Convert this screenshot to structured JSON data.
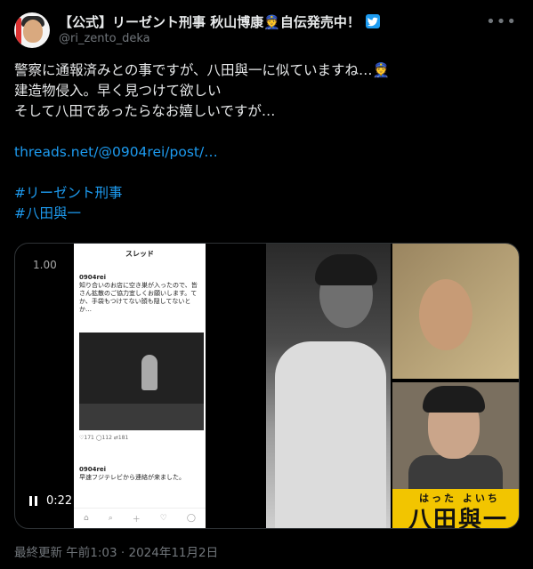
{
  "author": {
    "display_name": "【公式】リーゼント刑事 秋山博康👮自伝発売中！",
    "handle": "@ri_zento_deka"
  },
  "post": {
    "lines": [
      "警察に通報済みとの事ですが、八田與一に似ていますね…👮",
      "建造物侵入。早く見つけて欲しい",
      "そして八田であったらなお嬉しいですが…"
    ],
    "link": "threads.net/@0904rei/post/…",
    "hashtags": [
      "#リーゼント刑事",
      "#八田與一"
    ]
  },
  "media": {
    "playback_speed": "1.00",
    "elapsed_time": "0:22",
    "phone_header": "スレッド",
    "phone_user": "0904rei",
    "phone_post_text": "知り合いのお店に空き巣が入ったので、皆さん拡散のご協力宜しくお願いします。てか、手袋もつけてない顔も隠してないとか…",
    "phone_stats": "♡171  ◯112  ⇄181",
    "phone_reply_user": "0904rei",
    "phone_reply_text": "早速フジテレビから連絡が来ました。",
    "caption_ruby": "はった よいち",
    "caption_name": "八田與一"
  },
  "timestamp": "最終更新 午前1:03 · 2024年11月2日",
  "colors": {
    "accent": "#1d9bf0",
    "background": "#000000",
    "muted": "#71767b"
  },
  "icons": [
    "verified-badge-icon",
    "more-icon",
    "pause-icon",
    "captions-icon"
  ]
}
